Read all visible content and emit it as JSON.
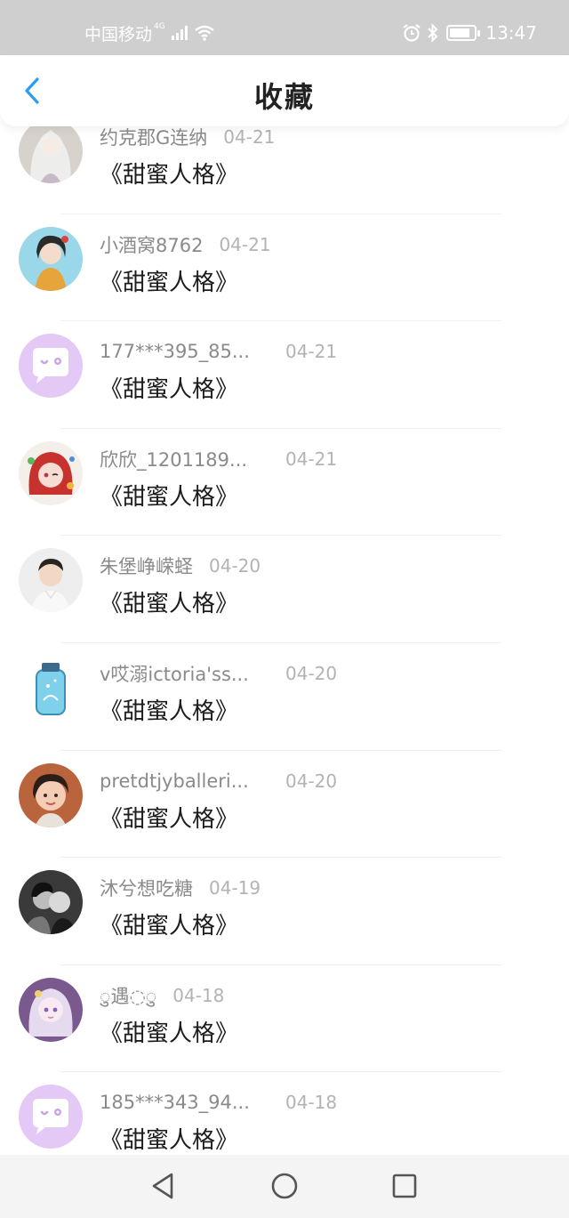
{
  "status_bar": {
    "carrier": "中国移动",
    "network": "4G",
    "time": "13:47",
    "battery_level": 0.85,
    "icons": [
      "signal-icon",
      "wifi-icon",
      "alarm-icon",
      "bluetooth-icon",
      "battery-icon"
    ]
  },
  "header": {
    "title": "收藏",
    "back_icon": "chevron-left-icon",
    "accent_color": "#2d9cf0"
  },
  "favorites": [
    {
      "user": "约克郡G连纳",
      "date": "04-21",
      "title": "《甜蜜人格》",
      "avatar": "photo-avatar-white-hair"
    },
    {
      "user": "小酒窝8762",
      "date": "04-21",
      "title": "《甜蜜人格》",
      "avatar": "photo-avatar-costume-girl"
    },
    {
      "user": "177***395_85...",
      "date": "04-21",
      "title": "《甜蜜人格》",
      "avatar": "default-chat-avatar"
    },
    {
      "user": "欣欣_1201189...",
      "date": "04-21",
      "title": "《甜蜜人格》",
      "avatar": "photo-avatar-red-hair-anime"
    },
    {
      "user": "朱堡峥嵘蛏",
      "date": "04-20",
      "title": "《甜蜜人格》",
      "avatar": "photo-avatar-boy"
    },
    {
      "user": "v哎溺ictoria'ss...",
      "date": "04-20",
      "title": "《甜蜜人格》",
      "avatar": "photo-avatar-bottle"
    },
    {
      "user": "pretdtjyballeri...",
      "date": "04-20",
      "title": "《甜蜜人格》",
      "avatar": "photo-avatar-child"
    },
    {
      "user": "沐兮想吃糖",
      "date": "04-19",
      "title": "《甜蜜人格》",
      "avatar": "photo-avatar-couple"
    },
    {
      "user": "◌ु遇◌ु",
      "date": "04-18",
      "title": "《甜蜜人格》",
      "avatar": "photo-avatar-anime-girl"
    },
    {
      "user": "185***343_94...",
      "date": "04-18",
      "title": "《甜蜜人格》",
      "avatar": "default-chat-avatar"
    }
  ],
  "nav_bar": {
    "icons": [
      "back-triangle-icon",
      "home-circle-icon",
      "recents-square-icon"
    ]
  }
}
